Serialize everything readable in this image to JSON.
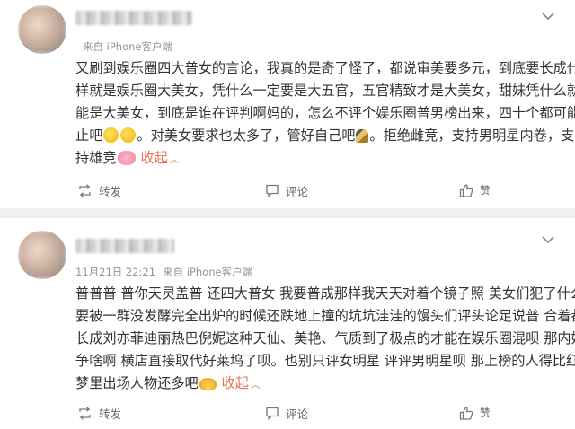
{
  "comments": [
    {
      "author_name": "",
      "timestamp": "",
      "source": "来自 iPhone客户端",
      "lines": [
        "又刷到娱乐圈四大普女的言论，我真的是奇了怪了，都说审美要多元，到底要长成什么",
        "样就是娱乐圈大美女，凭什么一定要是大五官，五官精致才是大美女，甜妹凭什么就不",
        "能是大美女，到底是谁在评判啊妈的，怎么不评个娱乐圈普男榜出来，四十个都可能不",
        "止吧",
        "。对美女要求也太多了，管好自己吧",
        "。拒绝雌竞，支持男明星内卷，支",
        "持雄竞"
      ],
      "collapse_label": "收起",
      "actions": {
        "repost": "转发",
        "comment": "评论",
        "like": "赞"
      },
      "emoji": [
        "smile-emoji",
        "smile-emoji",
        "nail-polish-emoji",
        "pig-emoji"
      ]
    },
    {
      "author_name": "",
      "timestamp": "11月21日 22:21",
      "source": "来自 iPhone客户端",
      "lines": [
        "普普普 普你天灵盖普 还四大普女 我要普成那样我天天对着个镜子照 美女们犯了什么罪",
        "要被一群没发酵完全出炉的时候还跌地上撞的坑坑洼洼的馒头们评头论足说普 合着都得",
        "长成刘亦菲迪丽热巴倪妮这种天仙、美艳、气质到了极点的才能在娱乐圈混呗 那内娱还",
        "争啥啊 横店直接取代好莱坞了呗。也别只评女明星 评评男明星呗 那上榜的人得比红楼",
        "梦里出场人物还多吧"
      ],
      "collapse_label": "收起",
      "actions": {
        "repost": "转发",
        "comment": "评论",
        "like": "赞"
      },
      "emoji": [
        "claw-hands-emoji"
      ]
    }
  ],
  "colors": {
    "accent": "#eb7350",
    "text": "#333333",
    "meta": "#939393",
    "background": "#eef0f2"
  }
}
